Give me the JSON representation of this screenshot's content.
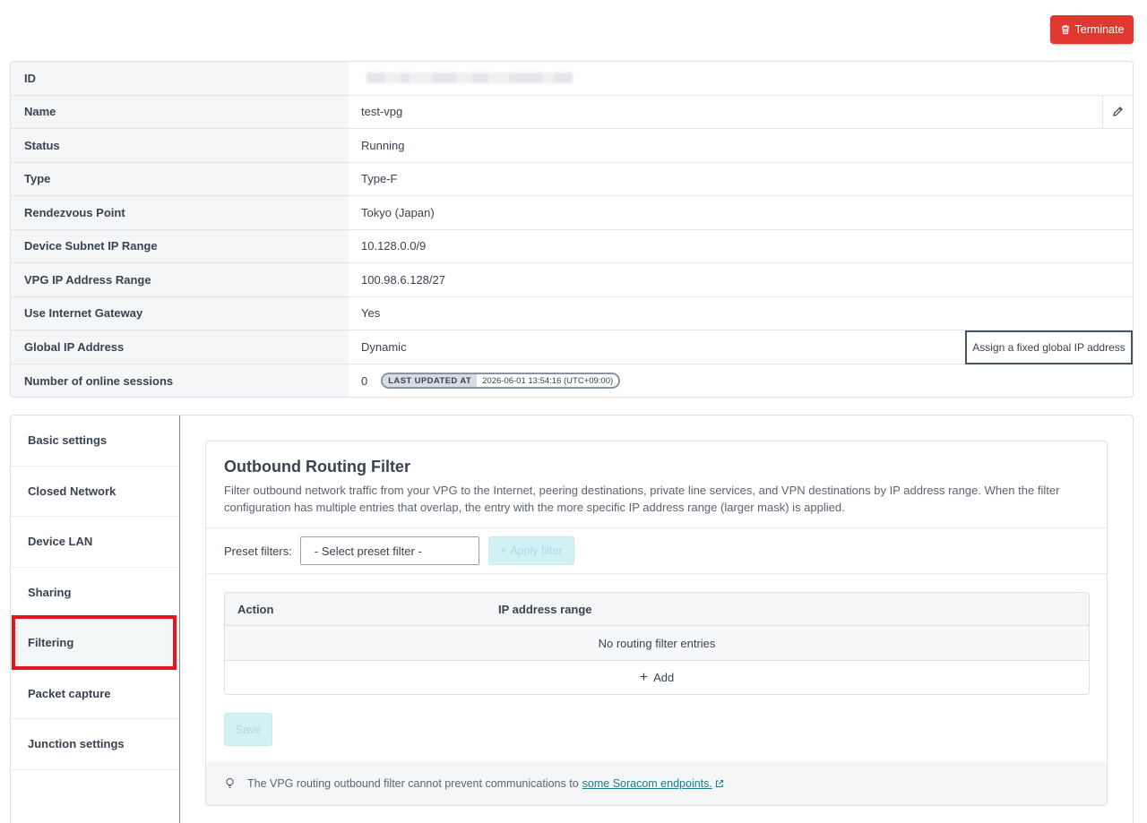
{
  "toolbar": {
    "terminate_label": "Terminate"
  },
  "info": {
    "id_label": "ID",
    "name_label": "Name",
    "name_value": "test-vpg",
    "status_label": "Status",
    "status_value": "Running",
    "type_label": "Type",
    "type_value": "Type-F",
    "rendezvous_label": "Rendezvous Point",
    "rendezvous_value": "Tokyo (Japan)",
    "subnet_label": "Device Subnet IP Range",
    "subnet_value": "10.128.0.0/9",
    "vpg_ip_label": "VPG IP Address Range",
    "vpg_ip_value": "100.98.6.128/27",
    "gateway_label": "Use Internet Gateway",
    "gateway_value": "Yes",
    "global_ip_label": "Global IP Address",
    "global_ip_value": "Dynamic",
    "assign_button": "Assign a fixed global IP address",
    "sessions_label": "Number of online sessions",
    "sessions_value": "0",
    "last_updated_label": "LAST UPDATED AT",
    "last_updated_value": "2026-06-01 13:54:16 (UTC+09:00)"
  },
  "sidebar": {
    "items": [
      {
        "label": "Basic settings"
      },
      {
        "label": "Closed Network"
      },
      {
        "label": "Device LAN"
      },
      {
        "label": "Sharing"
      },
      {
        "label": "Filtering"
      },
      {
        "label": "Packet capture"
      },
      {
        "label": "Junction settings"
      }
    ],
    "active": "Filtering"
  },
  "filter": {
    "title": "Outbound Routing Filter",
    "description": "Filter outbound network traffic from your VPG to the Internet, peering destinations, private line services, and VPN destinations by IP address range. When the filter configuration has multiple entries that overlap, the entry with the more specific IP address range (larger mask) is applied.",
    "preset_label": "Preset filters:",
    "preset_placeholder": "- Select preset filter -",
    "apply_label": "Apply filter",
    "table": {
      "col_action": "Action",
      "col_ip": "IP address range",
      "empty": "No routing filter entries",
      "add": "Add"
    },
    "save_label": "Save",
    "footer_text": "The VPG routing outbound filter cannot prevent communications to",
    "footer_link": "some Soracom endpoints."
  },
  "colors": {
    "danger": "#e0382f",
    "highlight": "#e8131b",
    "accent_disabled": "#d2f1f5",
    "link": "#1c7c8c"
  }
}
